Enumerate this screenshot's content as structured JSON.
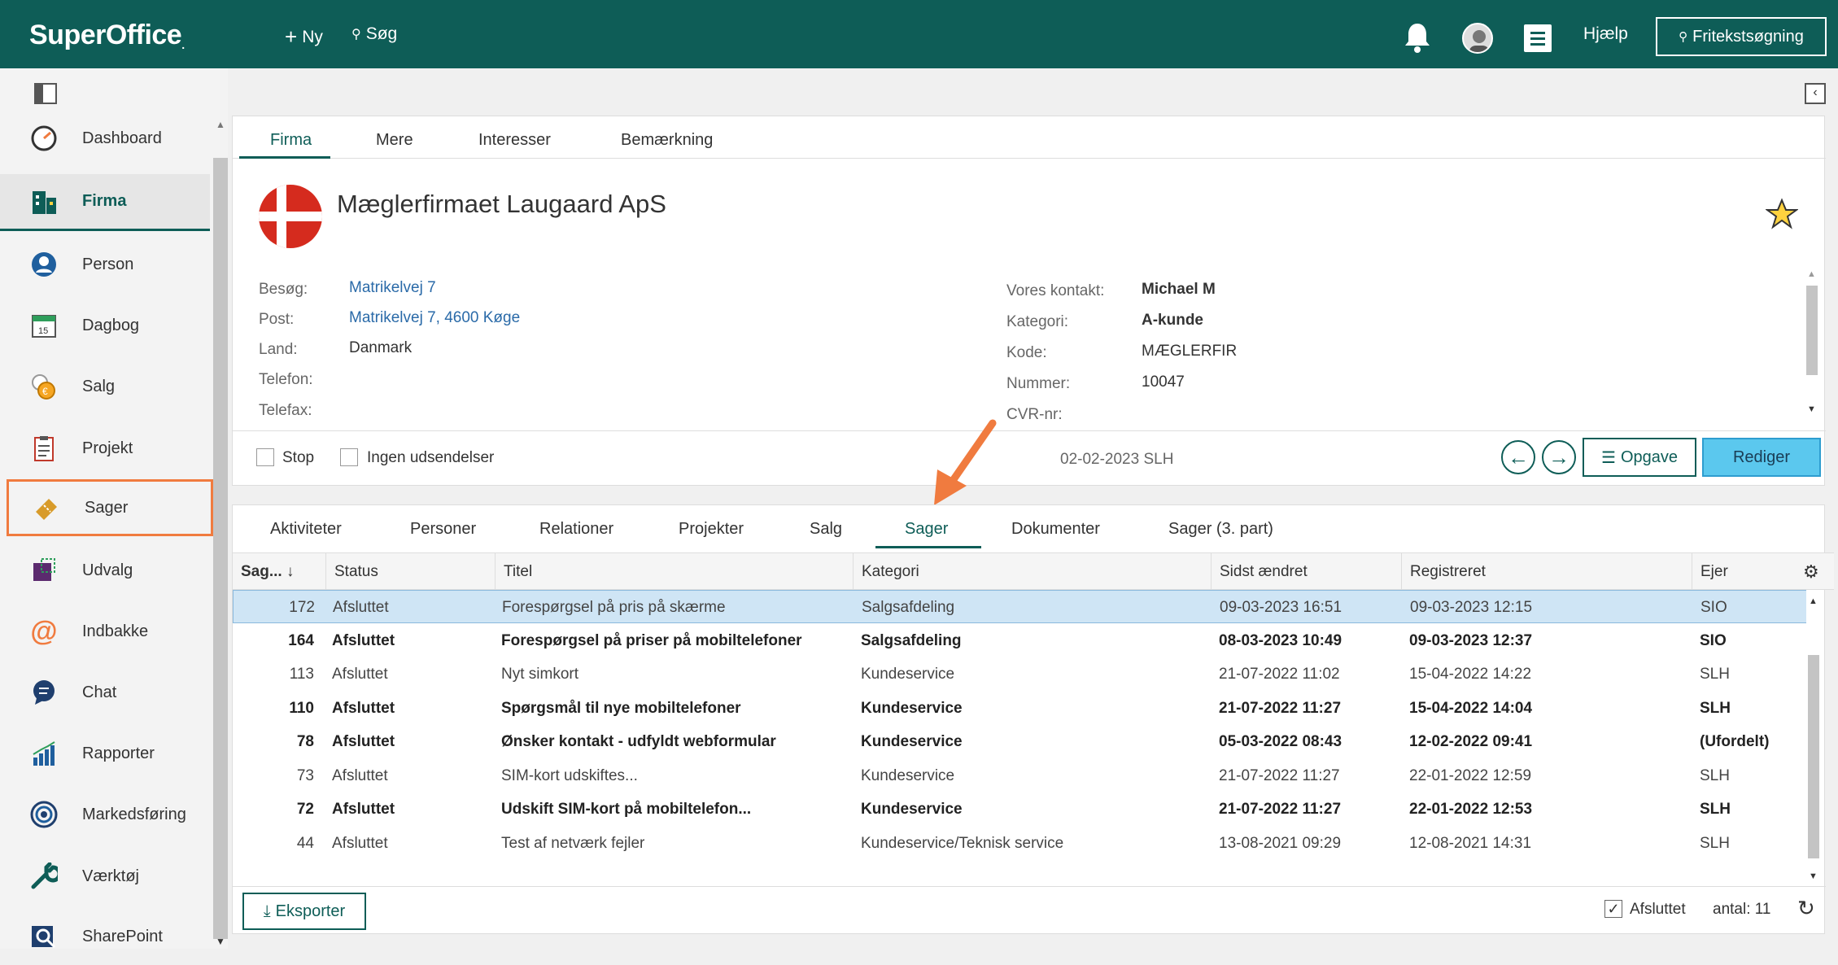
{
  "app": {
    "brand": "SuperOffice",
    "new_label": "Ny",
    "search_label": "Søg",
    "help_label": "Hjælp",
    "freetext_label": "Fritekstsøgning"
  },
  "nav": {
    "items": [
      {
        "label": "Dashboard",
        "icon": "dashboard-icon"
      },
      {
        "label": "Firma",
        "icon": "company-icon"
      },
      {
        "label": "Person",
        "icon": "person-icon"
      },
      {
        "label": "Dagbog",
        "icon": "calendar-icon"
      },
      {
        "label": "Salg",
        "icon": "sale-icon"
      },
      {
        "label": "Projekt",
        "icon": "project-icon"
      },
      {
        "label": "Sager",
        "icon": "ticket-icon"
      },
      {
        "label": "Udvalg",
        "icon": "selection-icon"
      },
      {
        "label": "Indbakke",
        "icon": "inbox-icon"
      },
      {
        "label": "Chat",
        "icon": "chat-icon"
      },
      {
        "label": "Rapporter",
        "icon": "reports-icon"
      },
      {
        "label": "Markedsføring",
        "icon": "marketing-icon"
      },
      {
        "label": "Værktøj",
        "icon": "tools-icon"
      },
      {
        "label": "SharePoint",
        "icon": "sharepoint-icon"
      }
    ]
  },
  "company": {
    "tabs": [
      "Firma",
      "Mere",
      "Interesser",
      "Bemærkning"
    ],
    "name": "Mæglerfirmaet Laugaard ApS",
    "left_fields": [
      {
        "label": "Besøg:",
        "value": "Matrikelvej 7"
      },
      {
        "label": "Post:",
        "value": "Matrikelvej 7, 4600 Køge"
      },
      {
        "label": "Land:",
        "value": "Danmark"
      },
      {
        "label": "Telefon:",
        "value": ""
      },
      {
        "label": "Telefax:",
        "value": ""
      }
    ],
    "right_fields": [
      {
        "label": "Vores kontakt:",
        "value": "Michael M"
      },
      {
        "label": "Kategori:",
        "value": "A-kunde"
      },
      {
        "label": "Kode:",
        "value": "MÆGLERFIR"
      },
      {
        "label": "Nummer:",
        "value": "10047"
      },
      {
        "label": "CVR-nr:",
        "value": ""
      }
    ],
    "stop_label": "Stop",
    "no_mail_label": "Ingen udsendelser",
    "updated": "02-02-2023 SLH",
    "task_label": "Opgave",
    "edit_label": "Rediger"
  },
  "related": {
    "tabs": [
      "Aktiviteter",
      "Personer",
      "Relationer",
      "Projekter",
      "Salg",
      "Sager",
      "Dokumenter",
      "Sager (3. part)"
    ],
    "columns": [
      "Sag...",
      "Status",
      "Titel",
      "Kategori",
      "Sidst ændret",
      "Registreret",
      "Ejer"
    ],
    "rows": [
      {
        "id": "172",
        "status": "Afsluttet",
        "title": "Forespørgsel på pris på skærme",
        "category": "Salgsafdeling",
        "changed": "09-03-2023 16:51",
        "registered": "09-03-2023 12:15",
        "owner": "SIO",
        "bold": false
      },
      {
        "id": "164",
        "status": "Afsluttet",
        "title": "Forespørgsel på priser på mobiltelefoner",
        "category": "Salgsafdeling",
        "changed": "08-03-2023 10:49",
        "registered": "09-03-2023 12:37",
        "owner": "SIO",
        "bold": true
      },
      {
        "id": "113",
        "status": "Afsluttet",
        "title": "Nyt simkort",
        "category": "Kundeservice",
        "changed": "21-07-2022 11:02",
        "registered": "15-04-2022 14:22",
        "owner": "SLH",
        "bold": false
      },
      {
        "id": "110",
        "status": "Afsluttet",
        "title": "Spørgsmål til nye mobiltelefoner",
        "category": "Kundeservice",
        "changed": "21-07-2022 11:27",
        "registered": "15-04-2022 14:04",
        "owner": "SLH",
        "bold": true
      },
      {
        "id": "78",
        "status": "Afsluttet",
        "title": "Ønsker kontakt - udfyldt webformular",
        "category": "Kundeservice",
        "changed": "05-03-2022 08:43",
        "registered": "12-02-2022 09:41",
        "owner": "(Ufordelt)",
        "bold": true
      },
      {
        "id": "73",
        "status": "Afsluttet",
        "title": "SIM-kort udskiftes...",
        "category": "Kundeservice",
        "changed": "21-07-2022 11:27",
        "registered": "22-01-2022 12:59",
        "owner": "SLH",
        "bold": false
      },
      {
        "id": "72",
        "status": "Afsluttet",
        "title": "Udskift SIM-kort på mobiltelefon...",
        "category": "Kundeservice",
        "changed": "21-07-2022 11:27",
        "registered": "22-01-2022 12:53",
        "owner": "SLH",
        "bold": true
      },
      {
        "id": "44",
        "status": "Afsluttet",
        "title": "Test af netværk fejler",
        "category": "Kundeservice/Teknisk service",
        "changed": "13-08-2021 09:29",
        "registered": "12-08-2021 14:31",
        "owner": "SLH",
        "bold": false
      }
    ],
    "export_label": "Eksporter",
    "closed_label": "Afsluttet",
    "count_label": "antal: 11"
  },
  "colors": {
    "brand": "#0e5d57",
    "highlight": "#f07b3f",
    "edit_button": "#5bc8ee",
    "selected_row": "#cfe5f5"
  }
}
